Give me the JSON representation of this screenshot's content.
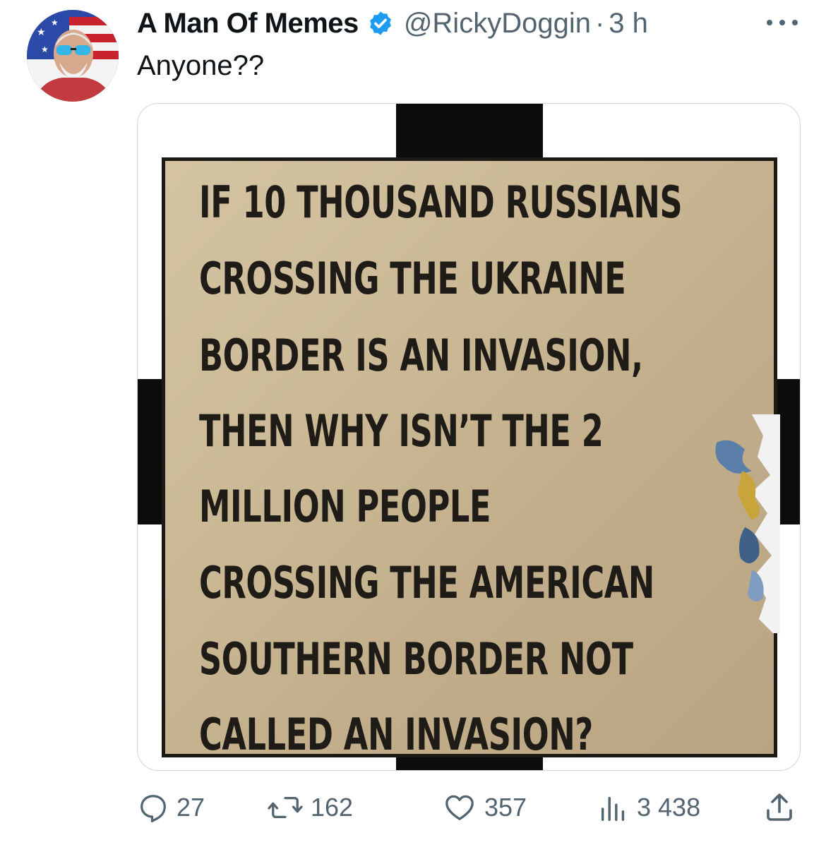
{
  "tweet": {
    "display_name": "A Man Of Memes",
    "handle": "@RickyDoggin",
    "separator": "·",
    "time": "3 h",
    "text": "Anyone??",
    "verified": true
  },
  "meme": {
    "lines": [
      "IF 10 THOUSAND RUSSIANS",
      "CROSSING THE UKRAINE",
      "BORDER IS AN INVASION,",
      "THEN WHY ISN’T THE 2",
      "MILLION PEOPLE",
      "CROSSING THE AMERICAN",
      "SOUTHERN BORDER NOT",
      "CALLED AN INVASION?"
    ]
  },
  "actions": {
    "replies": "27",
    "reposts": "162",
    "likes": "357",
    "views": "3 438"
  },
  "icons": {
    "more": "more-horizontal-icon",
    "verified": "verified-badge-icon",
    "reply": "reply-icon",
    "repost": "repost-icon",
    "like": "heart-icon",
    "views": "views-icon",
    "share": "share-icon"
  },
  "colors": {
    "text": "#0f1419",
    "secondary": "#536471",
    "verified": "#1d9bf0",
    "border": "#cfd9de"
  }
}
